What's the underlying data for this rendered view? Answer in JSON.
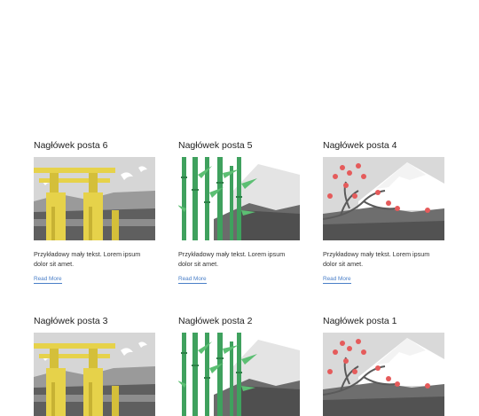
{
  "posts": [
    {
      "title": "Nagłówek posta 6",
      "excerpt": "Przykładowy mały tekst. Lorem ipsum dolor sit amet.",
      "read_more": "Read More",
      "image": "torii-gate"
    },
    {
      "title": "Nagłówek posta 5",
      "excerpt": "Przykładowy mały tekst. Lorem ipsum dolor sit amet.",
      "read_more": "Read More",
      "image": "bamboo"
    },
    {
      "title": "Nagłówek posta 4",
      "excerpt": "Przykładowy mały tekst. Lorem ipsum dolor sit amet.",
      "read_more": "Read More",
      "image": "cherry-blossom"
    },
    {
      "title": "Nagłówek posta 3",
      "image": "torii-gate"
    },
    {
      "title": "Nagłówek posta 2",
      "image": "bamboo"
    },
    {
      "title": "Nagłówek posta 1",
      "image": "cherry-blossom"
    }
  ],
  "colors": {
    "link": "#4a7fc8",
    "gate": "#e6d24a",
    "bamboo": "#3fa15e",
    "blossom": "#e55b5b"
  }
}
